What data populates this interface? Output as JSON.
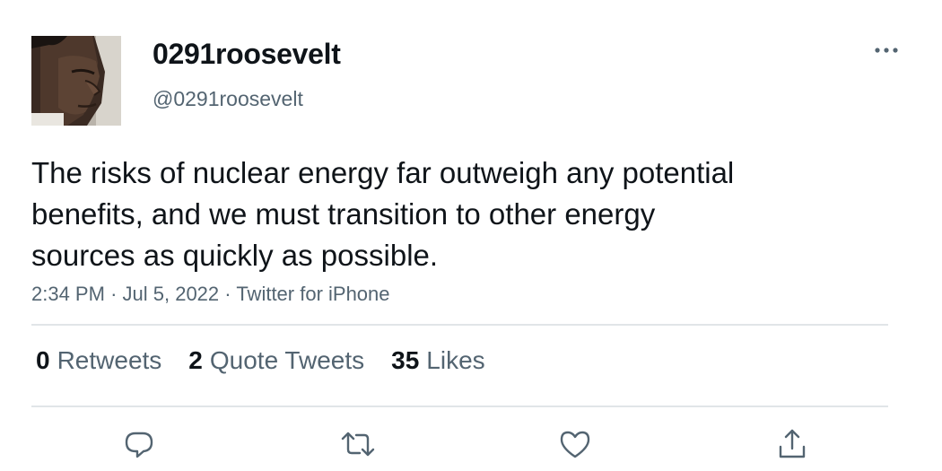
{
  "user": {
    "display_name": "0291roosevelt",
    "handle": "@0291roosevelt",
    "avatar_icon": "avatar-photo-icon"
  },
  "tweet": {
    "lines": [
      "The risks of nuclear energy far outweigh any potential",
      "benefits, and we must transition to other energy",
      "sources as quickly as possible."
    ],
    "time": "2:34 PM",
    "date": "Jul 5, 2022",
    "source": "Twitter for iPhone",
    "separator": "·"
  },
  "stats": {
    "retweets": {
      "count": "0",
      "label": "Retweets"
    },
    "quotes": {
      "count": "2",
      "label": "Quote Tweets"
    },
    "likes": {
      "count": "35",
      "label": "Likes"
    }
  },
  "actions": [
    "reply-icon",
    "retweet-icon",
    "like-icon",
    "share-icon"
  ],
  "colors": {
    "text_primary": "#0f1419",
    "text_secondary": "#536471",
    "divider": "#e1e5e8"
  }
}
